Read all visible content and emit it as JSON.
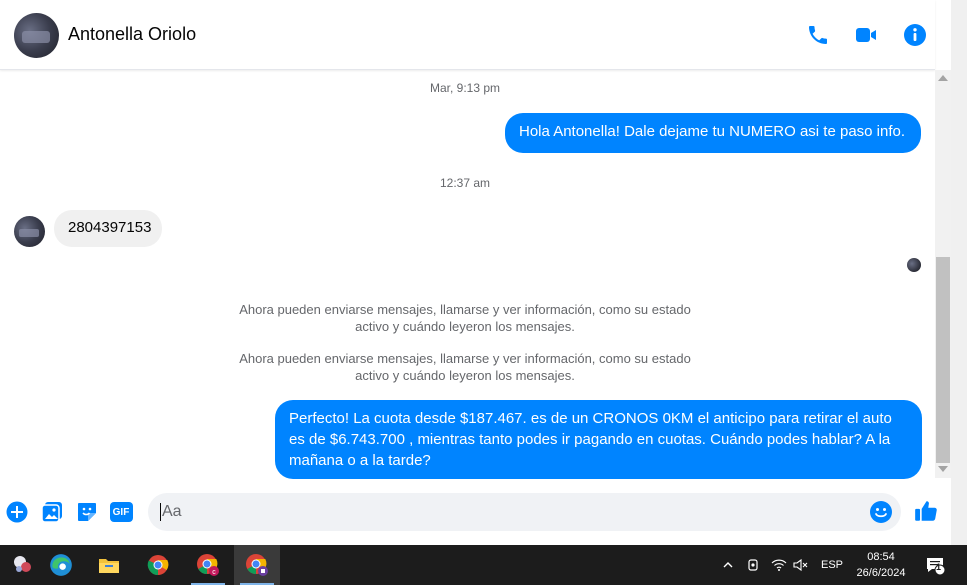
{
  "header": {
    "contact_name": "Antonella Oriolo"
  },
  "messages": {
    "ts1": "Mar, 9:13 pm",
    "out1": "Hola Antonella! Dale dejame tu NUMERO asi te paso info.",
    "ts2": "12:37 am",
    "in1": "2804397153",
    "note1_line1": "Ahora pueden enviarse mensajes, llamarse y ver información, como su estado",
    "note1_line2": "activo y cuándo leyeron los mensajes.",
    "note2_line1": "Ahora pueden enviarse mensajes, llamarse y ver información, como su estado",
    "note2_line2": "activo y cuándo leyeron los mensajes.",
    "out2_line1": "Perfecto! La cuota desde $187.467. es de un CRONOS 0KM el anticipo para retirar el auto",
    "out2_line2": "es de $6.743.700 , mientras tanto podes ir pagando en cuotas. Cuándo podes hablar? A la",
    "out2_line3": "mañana o a la tarde?"
  },
  "composer": {
    "placeholder": "Aa",
    "gif_label": "GIF"
  },
  "taskbar": {
    "language": "ESP",
    "time": "08:54",
    "date": "26/6/2024",
    "notification_count": "1"
  },
  "colors": {
    "accent": "#0084ff",
    "incoming_bubble": "#f0f0f0",
    "taskbar": "#1c1c1c"
  },
  "icons": [
    "phone-icon",
    "video-icon",
    "info-icon",
    "plus-icon",
    "image-icon",
    "sticker-icon",
    "gif-icon",
    "emoji-icon",
    "like-icon"
  ]
}
